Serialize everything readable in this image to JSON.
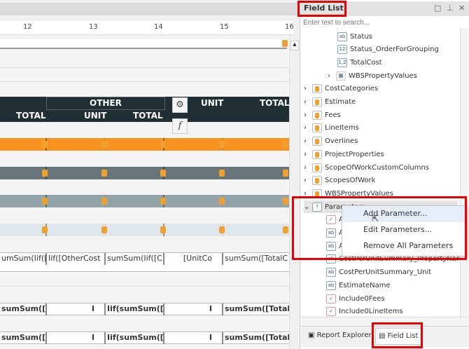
{
  "ruler": [
    "12",
    "13",
    "14",
    "15",
    "16"
  ],
  "header": {
    "other": "OTHER",
    "unit": "UNIT",
    "total": "TOTAL",
    "unit2": "UNIT",
    "total2": "TOTAL",
    "left_total": "TOTAL"
  },
  "toolbar": {
    "gear": "⚙",
    "fx": "f"
  },
  "formula_row": [
    "umSum(Iif([S",
    "Iif([OtherCost",
    "sumSum(Iif([C",
    "[UnitCo",
    "sumSum([TotalC"
  ],
  "bold_row1": [
    "sumSum([T",
    "I",
    "Iif(sumSum([",
    "I",
    "sumSum([TotalC"
  ],
  "bold_row2": [
    "sumSum([T",
    "I",
    "Iif(sumSum([",
    "I",
    "sumSum([TotalC"
  ],
  "panel": {
    "title": "Field List",
    "search_placeholder": "Enter text to search..."
  },
  "tree": [
    {
      "label": "Status",
      "icon": "ab",
      "level": 3
    },
    {
      "label": "Status_OrderForGrouping",
      "icon": "12",
      "level": 3
    },
    {
      "label": "TotalCost",
      "icon": "1,2",
      "level": 3
    },
    {
      "label": "WBSPropertyValues",
      "icon": "table",
      "level": 2,
      "chev": "›"
    },
    {
      "label": "CostCategories",
      "icon": "ds",
      "level": 1,
      "chev": "›"
    },
    {
      "label": "Estimate",
      "icon": "ds",
      "level": 1,
      "chev": "›"
    },
    {
      "label": "Fees",
      "icon": "ds",
      "level": 1,
      "chev": "›"
    },
    {
      "label": "LineItems",
      "icon": "ds",
      "level": 1,
      "chev": "›"
    },
    {
      "label": "Overlines",
      "icon": "ds",
      "level": 1,
      "chev": "›"
    },
    {
      "label": "ProjectProperties",
      "icon": "ds",
      "level": 1,
      "chev": "›"
    },
    {
      "label": "ScopeOfWorkCustomColumns",
      "icon": "ds",
      "level": 1,
      "chev": "›"
    },
    {
      "label": "ScopesOfWork",
      "icon": "ds",
      "level": 1,
      "chev": "›"
    },
    {
      "label": "WBSPropertyValues",
      "icon": "ds",
      "level": 1,
      "chev": "›"
    },
    {
      "label": "Parameters",
      "icon": "?",
      "level": 1,
      "chev": "⌄"
    },
    {
      "label": "A",
      "icon": "✓",
      "level": 2
    },
    {
      "label": "A",
      "icon": "ab",
      "level": 2
    },
    {
      "label": "A",
      "icon": "ab",
      "level": 2
    },
    {
      "label": "CostPerUnitSummary_PropertyName",
      "icon": "ab",
      "level": 2
    },
    {
      "label": "CostPerUnitSummary_Unit",
      "icon": "ab",
      "level": 2
    },
    {
      "label": "EstimateName",
      "icon": "ab",
      "level": 2
    },
    {
      "label": "Include0Fees",
      "icon": "✓",
      "level": 2
    },
    {
      "label": "Include0LineItems",
      "icon": "✓",
      "level": 2
    }
  ],
  "context_menu": [
    "Add Parameter...",
    "Edit Parameters...",
    "Remove All Parameters"
  ],
  "bottom_tabs": {
    "report_explorer": "Report Explorer",
    "field_list": "Field List"
  },
  "colors": {
    "orange": "#f7931e",
    "dark": "#1f2f33",
    "highlight": "#e00000"
  }
}
